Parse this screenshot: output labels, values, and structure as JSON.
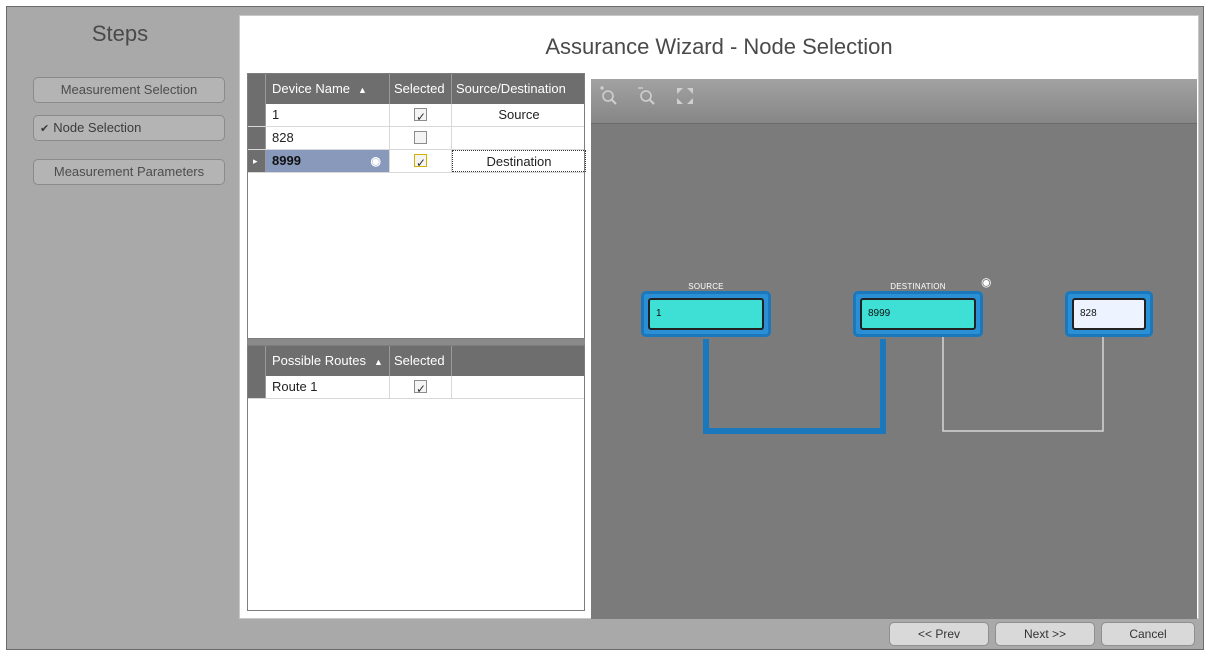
{
  "steps": {
    "title": "Steps",
    "items": [
      {
        "label": "Measurement Selection",
        "active": false
      },
      {
        "label": "Node Selection",
        "active": true,
        "check": "✔"
      },
      {
        "label": "Measurement Parameters",
        "active": false
      }
    ]
  },
  "main": {
    "title": "Assurance Wizard - Node Selection"
  },
  "device_grid": {
    "columns": [
      "Device Name",
      "Selected",
      "Source/Destination"
    ],
    "rows": [
      {
        "name": "1",
        "selected": true,
        "role": "Source"
      },
      {
        "name": "828",
        "selected": false,
        "role": ""
      },
      {
        "name": "8999",
        "selected": true,
        "role": "Destination"
      }
    ]
  },
  "routes_grid": {
    "columns": [
      "Possible Routes",
      "Selected"
    ],
    "rows": [
      {
        "name": "Route 1",
        "selected": true
      }
    ]
  },
  "topology": {
    "toolbar": [
      "zoom-in-icon",
      "zoom-out-icon",
      "fit-to-screen-icon"
    ],
    "nodes": [
      {
        "id": "1",
        "label": "SOURCE"
      },
      {
        "id": "8999",
        "label": "DESTINATION"
      },
      {
        "id": "828",
        "label": ""
      }
    ],
    "colors": {
      "node_fill": "#3ee0d5",
      "route_line": "#1c78bd",
      "other_line": "#d6d6d6",
      "canvas": "#7b7b7b"
    }
  },
  "footer": {
    "prev": "<< Prev",
    "next": "Next >>",
    "cancel": "Cancel"
  }
}
